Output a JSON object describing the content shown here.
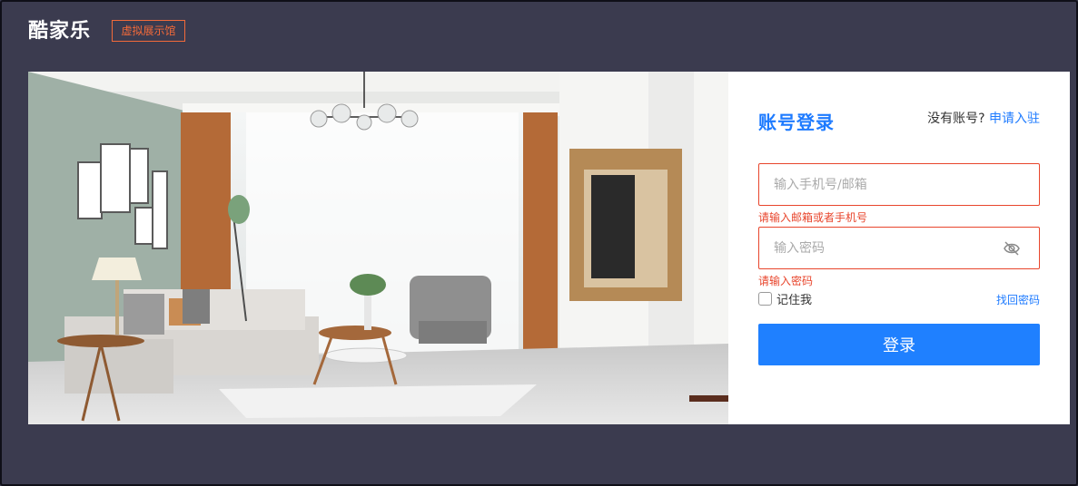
{
  "header": {
    "brand": "酷家乐",
    "tag": "虚拟展示馆"
  },
  "login": {
    "title": "账号登录",
    "no_account_text": "没有账号?",
    "signup_link": "申请入驻",
    "account_placeholder": "输入手机号/邮箱",
    "account_value": "",
    "account_error": "请输入邮箱或者手机号",
    "password_placeholder": "输入密码",
    "password_value": "",
    "password_error": "请输入密码",
    "remember_label": "记住我",
    "remember_checked": false,
    "forgot_link": "找回密码",
    "submit_label": "登录"
  },
  "icons": {
    "password_toggle": "eye-off-icon"
  },
  "colors": {
    "background": "#3b3b4f",
    "accent": "#1f80ff",
    "error": "#e8452c",
    "tag": "#f26a3a"
  }
}
